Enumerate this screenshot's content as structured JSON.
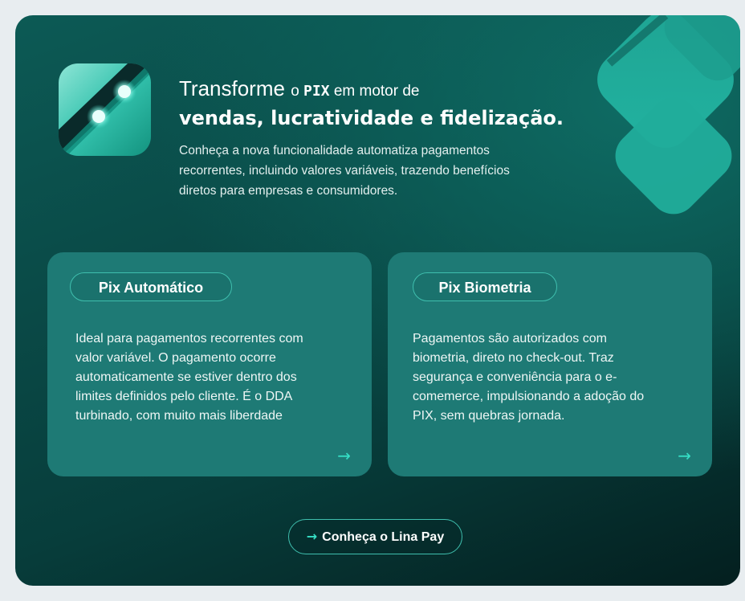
{
  "hero": {
    "line1_a": "Transforme ",
    "line1_b": "o ",
    "line1_pix": "PIX",
    "line1_c": " em motor de",
    "line2": "vendas, lucratividade e fidelização.",
    "intro": "Conheça a nova funcionalidade automatiza pagamentos recorrentes, incluindo valores variáveis, trazendo benefícios diretos para empresas e consumidores."
  },
  "cards": [
    {
      "title": "Pix Automático",
      "text": "Ideal para pagamentos recorrentes com valor variável. O pagamento ocorre automaticamente se estiver dentro dos limites definidos pelo cliente. É o DDA turbinado, com muito mais liberdade",
      "arrow": "→"
    },
    {
      "title": "Pix Biometria",
      "text": "Pagamentos são autorizados com biometria, direto no check-out. Traz segurança e conveniência para o e-comemerce, impulsionando a adoção do PIX, sem quebras jornada.",
      "arrow": "→"
    }
  ],
  "cta": {
    "arrow": "→",
    "label": "Conheça o Lina Pay"
  },
  "icons": {
    "app_icon": "pix-app-icon",
    "decoration": "pix-logo-decoration"
  },
  "colors": {
    "accent": "#36e0c6",
    "card": "#1e7a75",
    "panel_dark": "#041f1f",
    "panel_teal": "#0c5a55"
  }
}
